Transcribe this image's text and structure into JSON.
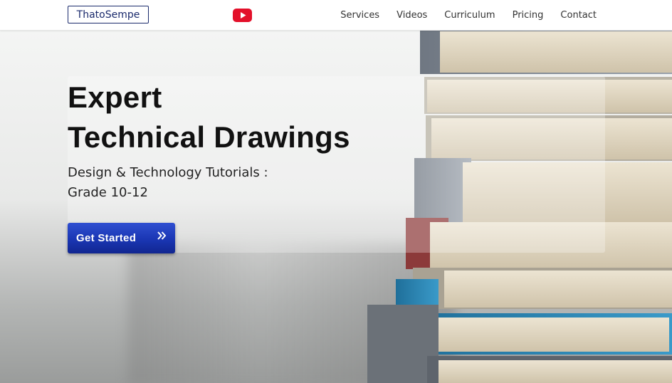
{
  "header": {
    "logo_text": "ThatoSempe",
    "youtube_icon": "youtube-icon",
    "nav": [
      {
        "label": "Services"
      },
      {
        "label": "Videos"
      },
      {
        "label": "Curriculum"
      },
      {
        "label": "Pricing"
      },
      {
        "label": "Contact"
      }
    ]
  },
  "hero": {
    "title_line1": "Expert",
    "title_line2": "Technical Drawings",
    "subtitle_line1": "Design & Technology Tutorials :",
    "subtitle_line2": "Grade 10-12",
    "cta_label": "Get Started",
    "cta_icon": "double-chevron-right-icon"
  },
  "colors": {
    "brand_blue": "#1a36b3",
    "youtube_red": "#e3102a",
    "logo_border": "#1a2a6c"
  }
}
